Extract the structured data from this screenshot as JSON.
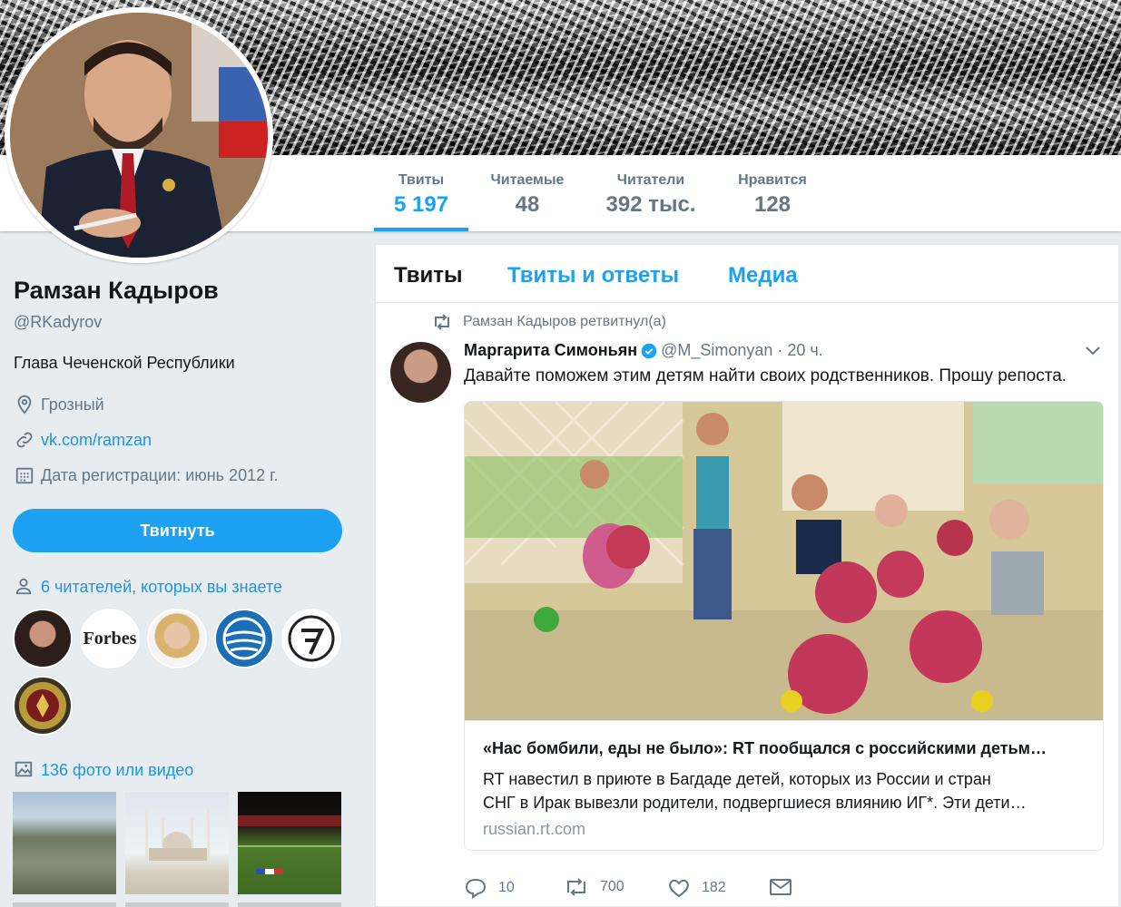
{
  "profile": {
    "name": "Рамзан Кадыров",
    "handle": "@RKadyrov",
    "bio": "Глава Чеченской Республики",
    "location": "Грозный",
    "website": "vk.com/ramzan",
    "joined": "Дата регистрации: июнь 2012 г."
  },
  "nav": {
    "stats": [
      {
        "label": "Твиты",
        "value": "5 197",
        "active": true
      },
      {
        "label": "Читаемые",
        "value": "48"
      },
      {
        "label": "Читатели",
        "value": "392 тыс."
      },
      {
        "label": "Нравится",
        "value": "128"
      }
    ]
  },
  "sidebar": {
    "tweet_button": "Твитнуть",
    "followers_you_know": "6 читателей, которых вы знаете",
    "follower_avatars": [
      "forbes-logo",
      "Forbes"
    ],
    "photos_link": "136 фото или видео"
  },
  "timeline": {
    "tabs": [
      "Твиты",
      "Твиты и ответы",
      "Медиа"
    ],
    "tweet": {
      "retweet_note": "Рамзан Кадыров ретвитнул(а)",
      "author_name": "Маргарита Симоньян",
      "author_handle": "@M_Simonyan",
      "time": "· 20 ч.",
      "text": "Давайте поможем этим детям найти своих родственников. Прошу репоста.",
      "card": {
        "title": "«Нас бомбили, еды не было»: RT пообщался с российскими детьм…",
        "description_line1": "RT навестил в приюте в Багдаде детей, которых из России и стран",
        "description_line2": "СНГ в Ирак вывезли родители, подвергшиеся влиянию ИГ*. Эти дети…",
        "url": "russian.rt.com"
      },
      "actions": {
        "replies": "10",
        "retweets": "700",
        "likes": "182"
      }
    }
  },
  "colors": {
    "accent": "#1da1f2",
    "link": "#1b95e0",
    "muted": "#657786",
    "background": "#e6ecf0"
  }
}
